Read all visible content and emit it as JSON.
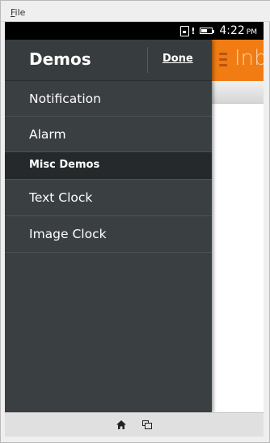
{
  "menubar": {
    "file_label_first": "F",
    "file_label_rest": "ile"
  },
  "statusbar": {
    "time": "4:22",
    "ampm": "PM",
    "battery_level": 0.6,
    "icons": [
      "sim-card-icon",
      "signal-alert-icon",
      "battery-icon"
    ]
  },
  "app": {
    "title": "Inb",
    "accent": "#f07c13"
  },
  "drawer": {
    "title": "Demos",
    "done_label": "Done",
    "items": [
      {
        "label": "Notification",
        "type": "item"
      },
      {
        "label": "Alarm",
        "type": "item"
      },
      {
        "label": "Misc Demos",
        "type": "section"
      },
      {
        "label": "Text Clock",
        "type": "item"
      },
      {
        "label": "Image Clock",
        "type": "item"
      }
    ],
    "background": "#3a3f42"
  },
  "navbar": {
    "icons": [
      "home-icon",
      "recent-apps-icon"
    ]
  }
}
